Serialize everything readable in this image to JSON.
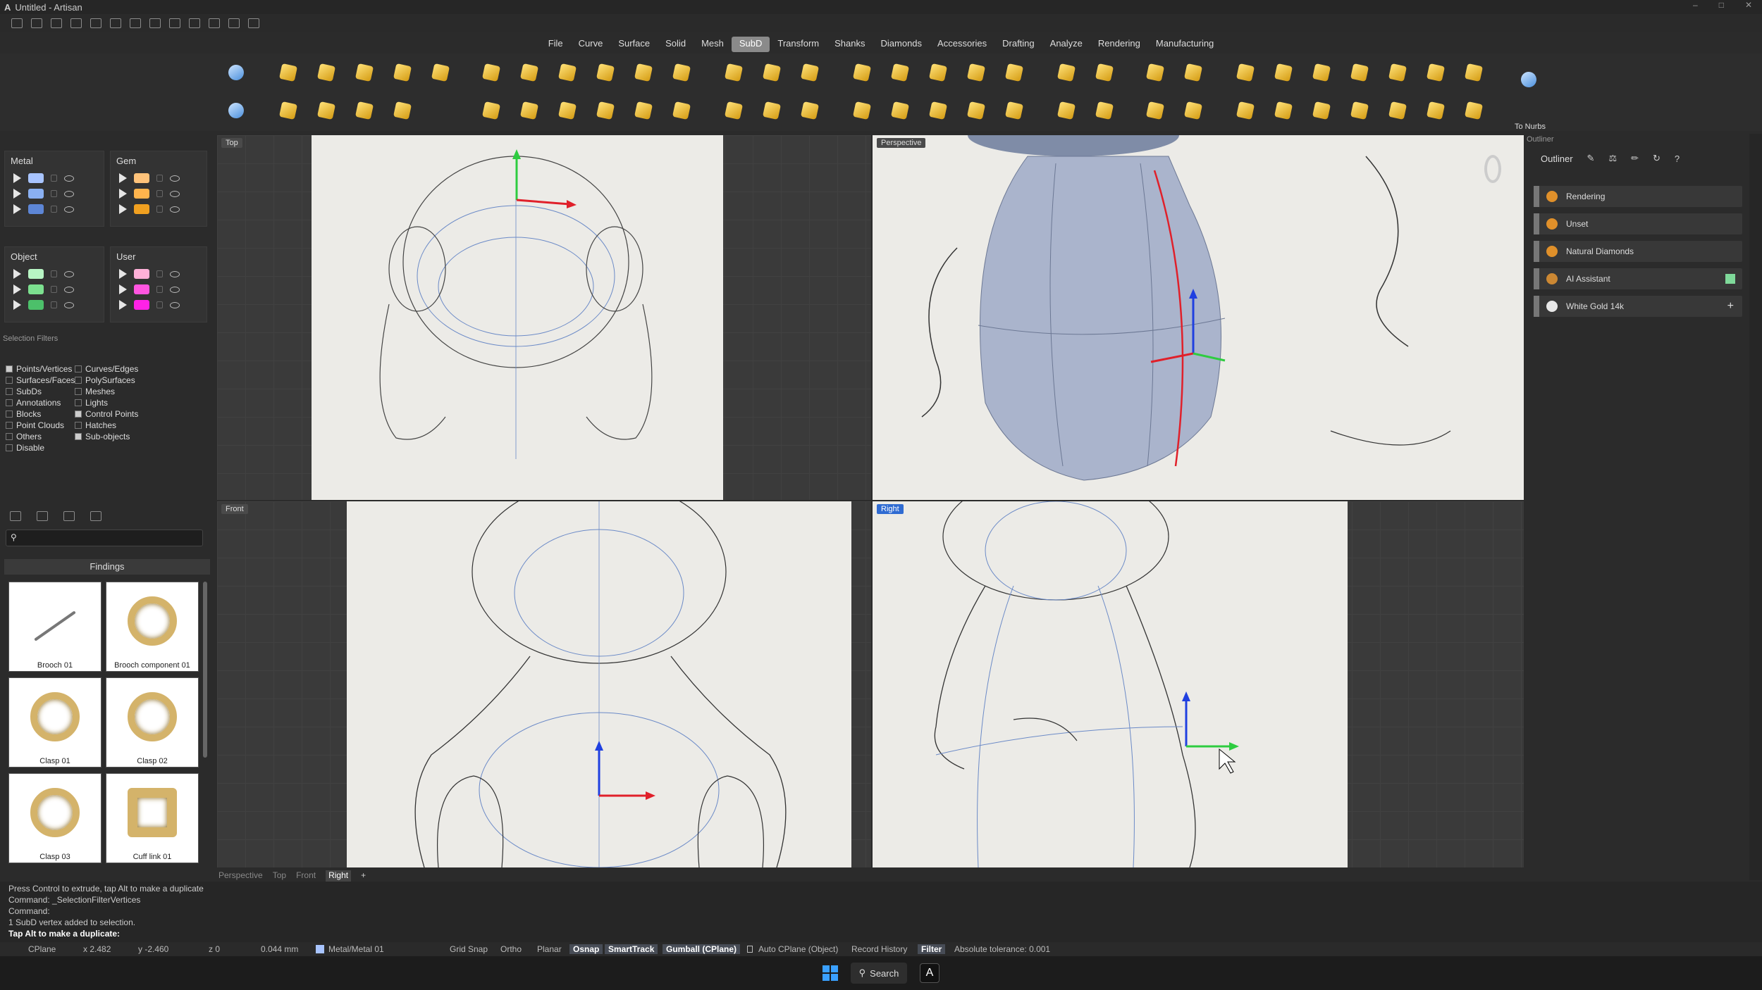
{
  "window": {
    "title": "Untitled - Artisan",
    "app_icon": "A"
  },
  "menu": [
    "File",
    "Curve",
    "Surface",
    "Solid",
    "Mesh",
    "SubD",
    "Transform",
    "Shanks",
    "Diamonds",
    "Accessories",
    "Drafting",
    "Analyze",
    "Rendering",
    "Manufacturing"
  ],
  "menu_active": "SubD",
  "toolbar": {
    "to_nurbs_label": "To Nurbs"
  },
  "layers": {
    "metal": {
      "title": "Metal",
      "colors": [
        "#a8c4ff",
        "#8ab0f2",
        "#5d86d6"
      ]
    },
    "gem": {
      "title": "Gem",
      "colors": [
        "#ffc37a",
        "#ffb44d",
        "#f0a020"
      ]
    },
    "object": {
      "title": "Object",
      "colors": [
        "#b8f5c4",
        "#7ce08f",
        "#4cc06a"
      ]
    },
    "user": {
      "title": "User",
      "colors": [
        "#ffb0d8",
        "#ff55e0",
        "#ff22e6"
      ]
    }
  },
  "selection_filters": {
    "title": "Selection Filters",
    "left": [
      {
        "label": "Points/Vertices",
        "checked": true
      },
      {
        "label": "Surfaces/Faces",
        "checked": false
      },
      {
        "label": "SubDs",
        "checked": false
      },
      {
        "label": "Annotations",
        "checked": false
      },
      {
        "label": "Blocks",
        "checked": false
      },
      {
        "label": "Point Clouds",
        "checked": false
      },
      {
        "label": "Others",
        "checked": false
      },
      {
        "label": "Disable",
        "checked": false
      }
    ],
    "right": [
      {
        "label": "Curves/Edges",
        "checked": false
      },
      {
        "label": "PolySurfaces",
        "checked": false
      },
      {
        "label": "Meshes",
        "checked": false
      },
      {
        "label": "Lights",
        "checked": false
      },
      {
        "label": "Control Points",
        "checked": true
      },
      {
        "label": "Hatches",
        "checked": false
      },
      {
        "label": "Sub-objects",
        "checked": true
      }
    ]
  },
  "library": {
    "findings_title": "Findings",
    "items": [
      "Brooch 01",
      "Brooch component 01",
      "Clasp 01",
      "Clasp 02",
      "Clasp 03",
      "Cuff link 01"
    ]
  },
  "viewports": {
    "top": "Top",
    "perspective": "Perspective",
    "front": "Front",
    "right": "Right",
    "tabs": [
      "Perspective",
      "Top",
      "Front",
      "Right"
    ],
    "active_tab": "Right"
  },
  "outliner": {
    "panel_title": "Outliner",
    "title": "Outliner",
    "rows": [
      {
        "label": "Rendering",
        "color": "#e0902a"
      },
      {
        "label": "Unset",
        "color": "#e0902a"
      },
      {
        "label": "Natural Diamonds",
        "color": "#e0902a"
      },
      {
        "label": "AI Assistant",
        "color": "#cc8833"
      },
      {
        "label": "White Gold 14k",
        "color": "#e8e8e8"
      }
    ]
  },
  "command": {
    "lines": [
      "Press Control to extrude, tap Alt to make a duplicate",
      "Command: _SelectionFilterVertices",
      "Command:",
      "1 SubD vertex added to selection."
    ],
    "prompt": "Tap Alt to make a duplicate:"
  },
  "status": {
    "cplane": "CPlane",
    "x": "x 2.482",
    "y": "y -2.460",
    "z": "z 0",
    "dist": "0.044 mm",
    "layer": "Metal/Metal 01",
    "grid_snap": "Grid Snap",
    "ortho": "Ortho",
    "planar": "Planar",
    "osnap": "Osnap",
    "smarttrack": "SmartTrack",
    "gumball": "Gumball (CPlane)",
    "auto_cplane": "Auto CPlane (Object)",
    "record_history": "Record History",
    "filter": "Filter",
    "tolerance": "Absolute tolerance: 0.001"
  },
  "taskbar": {
    "search": "Search"
  }
}
